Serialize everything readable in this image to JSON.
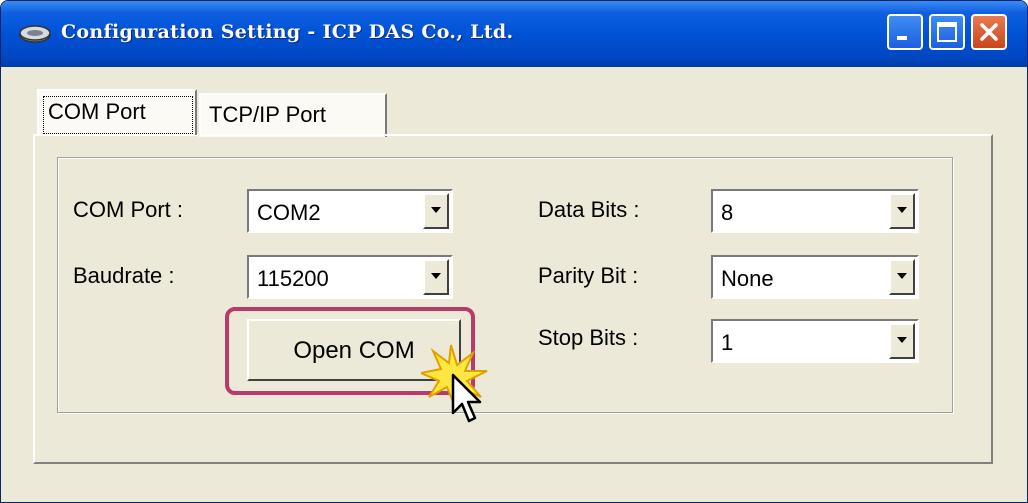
{
  "window": {
    "title": "Configuration Setting - ICP DAS Co., Ltd.",
    "app_icon": "link-icon",
    "controls": [
      "minimize-icon",
      "maximize-icon",
      "close-icon"
    ]
  },
  "tabs": [
    {
      "label": "COM Port",
      "active": true
    },
    {
      "label": "TCP/IP Port",
      "active": false
    }
  ],
  "settings": {
    "com_port": {
      "label": "COM Port :",
      "value": "COM2"
    },
    "baudrate": {
      "label": "Baudrate :",
      "value": "115200"
    },
    "data_bits": {
      "label": "Data Bits :",
      "value": "8"
    },
    "parity_bit": {
      "label": "Parity Bit :",
      "value": "None"
    },
    "stop_bits": {
      "label": "Stop Bits :",
      "value": "1"
    }
  },
  "open_button": {
    "label": "Open COM"
  },
  "colors": {
    "titlebar": "#0052d6",
    "close_button": "#c9461c",
    "highlight_border": "#b83a6a",
    "window_background": "#ece9d8"
  }
}
